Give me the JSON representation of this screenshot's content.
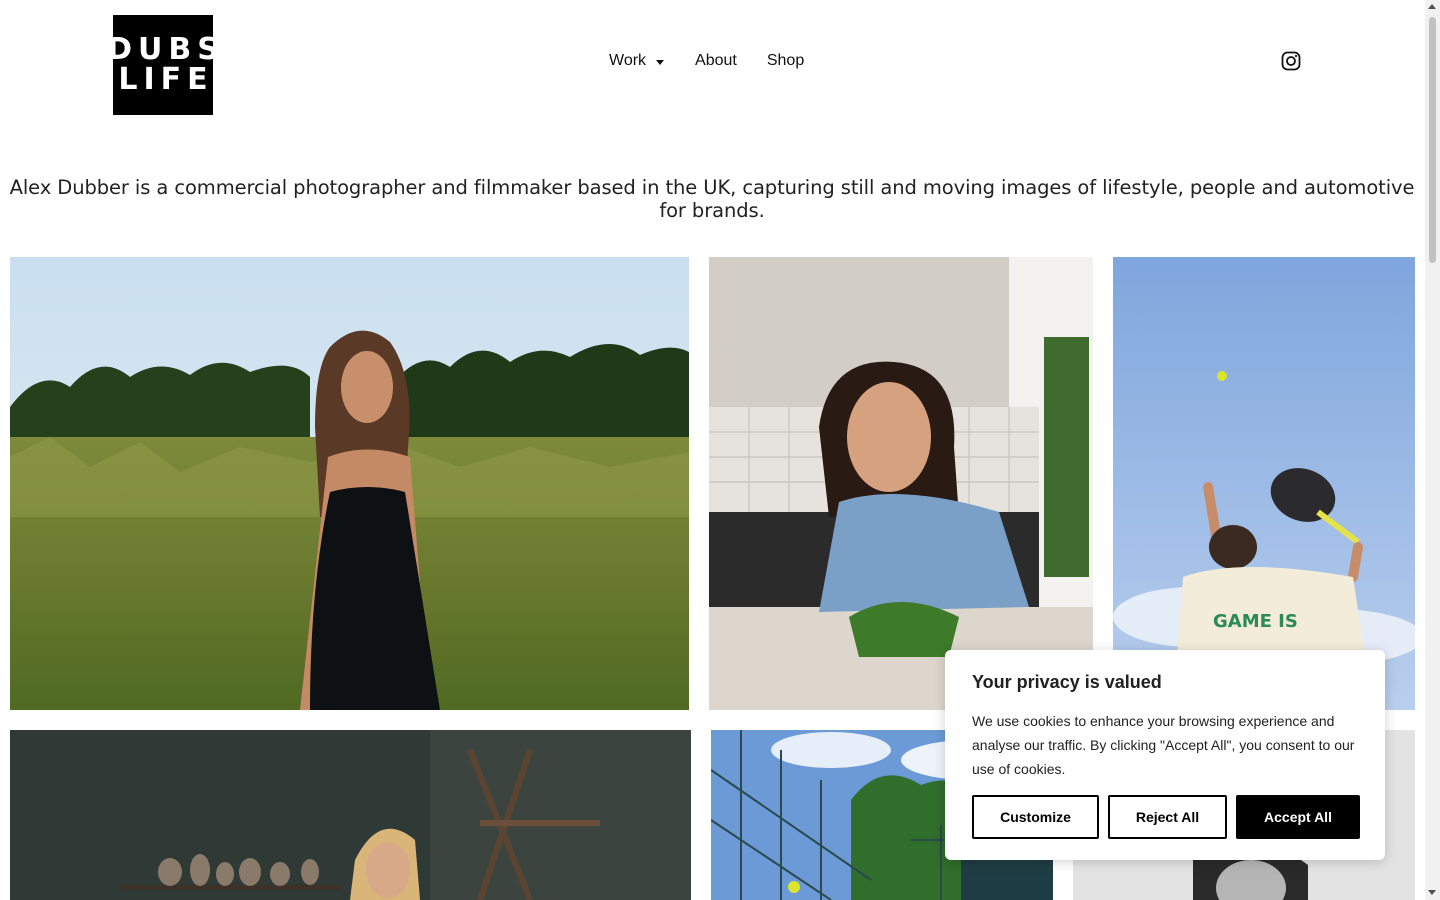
{
  "logo": {
    "line1": "DUBS",
    "line2": "LIFE"
  },
  "nav": {
    "items": [
      {
        "label": "Work"
      },
      {
        "label": "About"
      },
      {
        "label": "Shop"
      }
    ]
  },
  "social": {
    "icon": "instagram-icon"
  },
  "intro": "Alex Dubber is a commercial photographer and filmmaker based in the UK, capturing still and moving images of lifestyle, people and automotive for brands.",
  "cookie": {
    "title": "Your privacy is valued",
    "body": "We use cookies to enhance your browsing experience and analyse our traffic. By clicking \"Accept All\", you consent to our use of cookies.",
    "customize": "Customize",
    "reject": "Reject All",
    "accept": "Accept All"
  },
  "colors": {
    "accent": "#000000",
    "background": "#ffffff",
    "text": "#111111"
  }
}
